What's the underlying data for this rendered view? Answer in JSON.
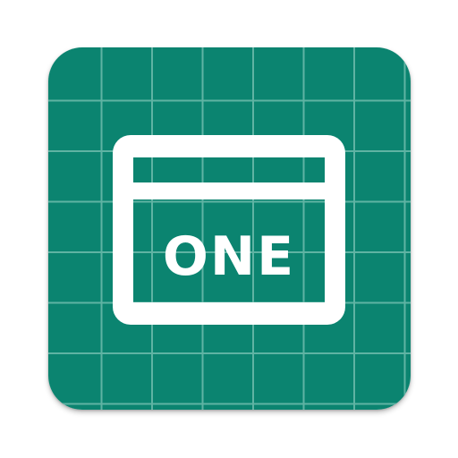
{
  "icon": {
    "name": "card-one-app-icon",
    "text": "ONE",
    "colors": {
      "background": "#0b8470",
      "grid": "#5fb3a3",
      "glyph": "#ffffff"
    }
  }
}
